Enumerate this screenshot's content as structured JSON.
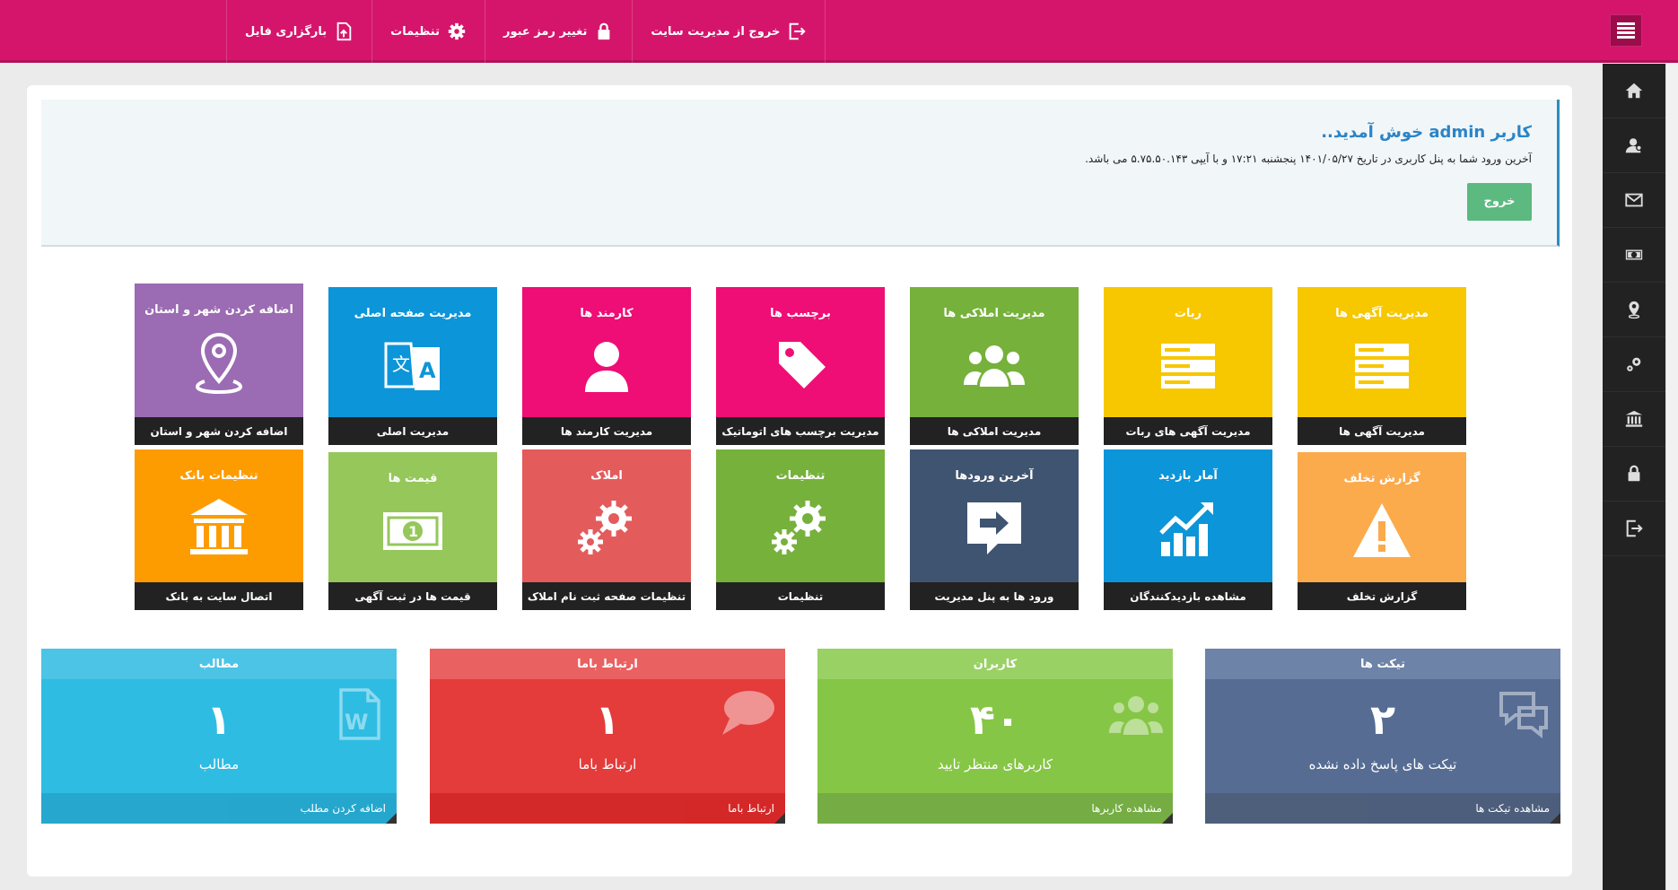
{
  "topnav": {
    "items": [
      {
        "label": "بارگزاری فایل",
        "icon": "file-upload-icon"
      },
      {
        "label": "تنظیمات",
        "icon": "gear-icon"
      },
      {
        "label": "تغییر رمز عبور",
        "icon": "lock-icon"
      },
      {
        "label": "خروج از مدیریت سایت",
        "icon": "sign-out-icon"
      }
    ]
  },
  "sidebar": {
    "items": [
      "home-icon",
      "user-icon",
      "envelope-icon",
      "money-icon",
      "map-marker-icon",
      "gears-icon",
      "bank-icon",
      "lock-icon",
      "sign-out-icon"
    ]
  },
  "welcome": {
    "title": "کاربر admin خوش آمدید..",
    "message": "آخرین ورود شما به پنل کاربری در تاریخ ۱۴۰۱/۰۵/۲۷ پنجشنبه ۱۷:۲۱ و با آیپی ۵.۷۵.۵۰.۱۴۳ می باشد.",
    "logout_label": "خروج"
  },
  "tiles": [
    {
      "title": "مدیریت آگهی ها",
      "footer": "مدیریت آگهی ها",
      "color": "#f7c700",
      "icon": "list-icon"
    },
    {
      "title": "ربات",
      "footer": "مدیریت آگهی های ربات",
      "color": "#f7c700",
      "icon": "list-icon"
    },
    {
      "title": "مدیریت املاکی ها",
      "footer": "مدیریت املاکی ها",
      "color": "#76b13b",
      "icon": "users-group-icon"
    },
    {
      "title": "برچسب ها",
      "footer": "مدیریت برچسب های اتوماتیک",
      "color": "#ee0e75",
      "icon": "tag-icon"
    },
    {
      "title": "کارمند ها",
      "footer": "مدیریت کارمند ها",
      "color": "#ee0e75",
      "icon": "user-icon"
    },
    {
      "title": "مدیریت صفحه اصلی",
      "footer": "مدیریت اصلی",
      "color": "#0c95d8",
      "icon": "translate-icon"
    },
    {
      "title": "اضافه کردن شهر و استان",
      "footer": "اضافه کردن شهر و استان",
      "color": "#9b6bb3",
      "icon": "map-pin-icon"
    },
    {
      "title": "گزارش تخلف",
      "footer": "گزارش تخلف",
      "color": "#fbaa4c",
      "icon": "warning-icon"
    },
    {
      "title": "آمار بازدید",
      "footer": "مشاهده بازدیدکنندگان",
      "color": "#0c95d8",
      "icon": "chart-up-icon"
    },
    {
      "title": "آخرین ورودها",
      "footer": "ورود ها به پنل مدیریت",
      "color": "#3f5470",
      "icon": "arrow-chat-icon"
    },
    {
      "title": "تنظیمات",
      "footer": "تنظیمات",
      "color": "#76b13b",
      "icon": "gears-icon"
    },
    {
      "title": "املاک",
      "footer": "تنظیمات صفحه ثبت نام املاک",
      "color": "#e45b5b",
      "icon": "gears-icon"
    },
    {
      "title": "قیمت ها",
      "footer": "قیمت ها در ثبت آگهی",
      "color": "#95c75a",
      "icon": "money-bill-icon"
    },
    {
      "title": "تنظیمات بانک",
      "footer": "اتصال سایت به بانک",
      "color": "#fd9c00",
      "icon": "bank-icon"
    }
  ],
  "stats": [
    {
      "header": "تیکت ها",
      "number": "۲",
      "label": "تیکت های پاسخ داده نشده",
      "footer": "مشاهده تیکت ها",
      "head_color": "#6d83a8",
      "body_color": "#566c93",
      "foot_color": "#445675",
      "icon": "comments-icon"
    },
    {
      "header": "کاربران",
      "number": "۴۰",
      "label": "کاربرهای منتظر تایید",
      "footer": "مشاهده کاربرها",
      "head_color": "#9ad165",
      "body_color": "#86c646",
      "foot_color": "#6ea93a",
      "icon": "users-group-icon"
    },
    {
      "header": "ارتباط باما",
      "number": "۱",
      "label": "ارتباط باما",
      "footer": "ارتباط باما",
      "head_color": "#ea6161",
      "body_color": "#e43b3b",
      "foot_color": "#d21d1d",
      "icon": "speech-bubble-icon"
    },
    {
      "header": "مطالب",
      "number": "۱",
      "label": "مطالب",
      "footer": "اضافه کردن مطلب",
      "head_color": "#4cc4e6",
      "body_color": "#2ebce3",
      "foot_color": "#1aa3cb",
      "icon": "word-file-icon"
    }
  ]
}
